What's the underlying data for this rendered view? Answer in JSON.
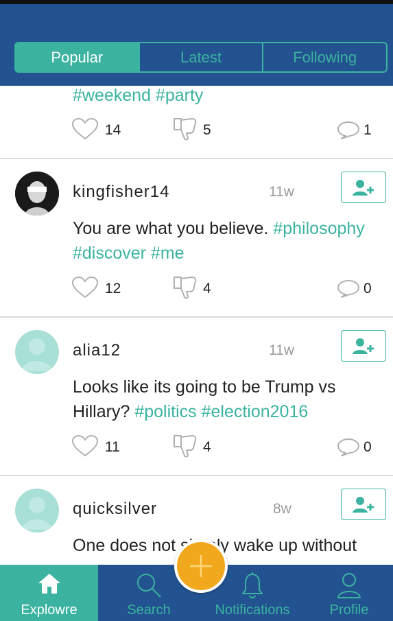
{
  "tabs": [
    {
      "label": "Popular",
      "active": true
    },
    {
      "label": "Latest",
      "active": false
    },
    {
      "label": "Following",
      "active": false
    }
  ],
  "posts": [
    {
      "username": "",
      "time": "",
      "text": "",
      "tags": "#weekend #party",
      "likes": "14",
      "dislikes": "5",
      "comments": "1"
    },
    {
      "username": "kingfisher14",
      "time": "11w",
      "text": "You are what you believe.",
      "tags": "#philosophy #discover #me",
      "likes": "12",
      "dislikes": "4",
      "comments": "0"
    },
    {
      "username": "alia12",
      "time": "11w",
      "text": "Looks like its going to be Trump vs Hillary?",
      "tags": "#politics #election2016",
      "likes": "11",
      "dislikes": "4",
      "comments": "0"
    },
    {
      "username": "quicksilver",
      "time": "8w",
      "text": "One does not simply wake up without",
      "tags": "",
      "likes": "",
      "dislikes": "",
      "comments": ""
    }
  ],
  "nav": {
    "explore": "Explowre",
    "search": "Search",
    "notifications": "Notifications",
    "profile": "Profile"
  },
  "colors": {
    "header_blue": "#22528f",
    "accent_teal": "#3bb3a0",
    "fab_orange": "#f2a81d"
  },
  "icons": [
    "heart-icon",
    "thumbs-down-icon",
    "comment-icon",
    "add-user-icon",
    "home-icon",
    "search-icon",
    "bell-icon",
    "person-icon",
    "plus-icon"
  ]
}
